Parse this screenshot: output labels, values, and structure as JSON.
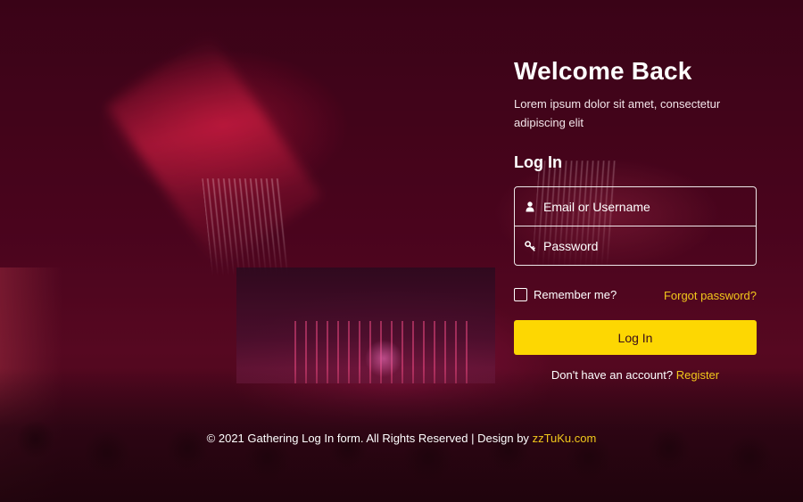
{
  "panel": {
    "title": "Welcome Back",
    "subtitle": "Lorem ipsum dolor sit amet, consectetur adipiscing elit",
    "section_title": "Log In",
    "email_placeholder": "Email or Username",
    "password_placeholder": "Password",
    "remember_label": "Remember me?",
    "forgot_label": "Forgot password?",
    "login_button_label": "Log In",
    "register_prompt": "Don't have an account?",
    "register_link": "Register"
  },
  "footer": {
    "text": "© 2021 Gathering Log In form. All Rights Reserved | Design by",
    "link": "zzTuKu.com"
  },
  "colors": {
    "accent": "#fdd702",
    "link": "#f2c81b",
    "background": "#4d061f"
  },
  "icons": {
    "email": "user-icon",
    "password": "key-icon"
  }
}
